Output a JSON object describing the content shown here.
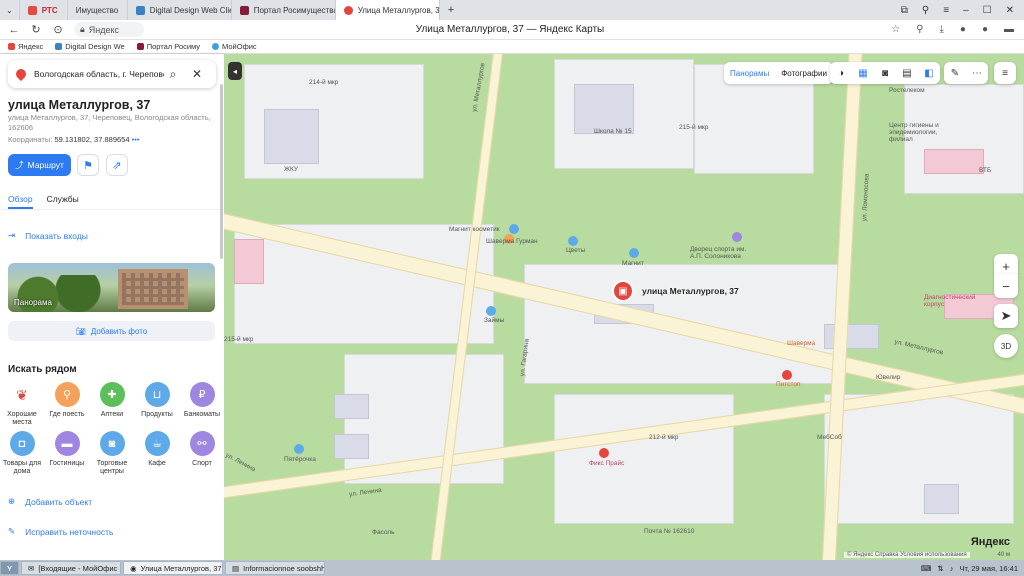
{
  "browser": {
    "tabs": [
      {
        "label": "Имущество",
        "color": "#e34b3f"
      },
      {
        "label": "Digital Design Web Client",
        "color": "#3b82c4"
      },
      {
        "label": "Портал Росимущества",
        "color": "#8a1a3a"
      },
      {
        "label": "Улица Металлургов, 37",
        "color": "#e4463b"
      }
    ],
    "rts_label": "РТС",
    "new_tab": "+",
    "page_title": "Улица Металлургов, 37 — Яндекс Карты",
    "url_text": "Яндекс",
    "bookmarks": [
      "Яндекс",
      "Digital Design We",
      "Портал Росиму",
      "МойОфис"
    ]
  },
  "sidebar": {
    "search_value": "Вологодская область, г. Череповец,",
    "title": "улица Металлургов, 37",
    "address": "улица Металлургов, 37, Череповец, Вологодская область, 162606",
    "coords_label": "Координаты:",
    "coords_value": "59.131802, 37.889654",
    "route_label": "Маршрут",
    "tabs": [
      "Обзор",
      "Службы"
    ],
    "show_entrances": "Показать входы",
    "panorama_label": "Панорама",
    "add_photo": "Добавить фото",
    "nearby_title": "Искать рядом",
    "categories": [
      {
        "label": "Хорошие места",
        "color": "#ffffff"
      },
      {
        "label": "Где поесть",
        "color": "#f4a259"
      },
      {
        "label": "Аптеки",
        "color": "#5bbf5a"
      },
      {
        "label": "Продукты",
        "color": "#5ea9e8"
      },
      {
        "label": "Банкоматы",
        "color": "#9f86e0"
      },
      {
        "label": "Товары для дома",
        "color": "#5ea9e8"
      },
      {
        "label": "Гостиницы",
        "color": "#9f86e0"
      },
      {
        "label": "Торговые центры",
        "color": "#5ea9e8"
      },
      {
        "label": "Кафе",
        "color": "#5ea9e8"
      },
      {
        "label": "Спорт",
        "color": "#9f86e0"
      }
    ],
    "add_object": "Добавить объект",
    "fix_error": "Исправить неточность"
  },
  "map": {
    "panoramas": "Панорамы",
    "photos": "Фотографии",
    "marker_label": "улица Металлургов, 37",
    "zoom_in": "+",
    "zoom_out": "−",
    "btn_3d": "3D",
    "brand": "Яндекс",
    "copyright": "© Яндекс  Справка  Условия использования",
    "scale": "40 м",
    "labels": {
      "street_metallurgov_w": "ул. Металлургов",
      "street_metallurgov_e": "ул. Металлургов",
      "street_lenina_w": "ул. Ленина",
      "street_lenina_e": "ул. Ленина",
      "street_gagarina": "ул. Гагарина",
      "street_lomonosova": "ул. Ломоносова",
      "school": "Школа № 15",
      "magnit_kosm": "Магнит косметик",
      "shaverma": "Шаверма Гурман",
      "tsvety": "Цветы",
      "magnit": "Магнит",
      "dvorets": "Дворец спорта им. А.П. Солоникова",
      "zaymi": "Займы",
      "shaverma2": "Шаверма",
      "pitstop": "Питстоп",
      "yuvelir": "Ювелир",
      "mebsob": "МебСоб",
      "pyaterochka": "Пятёрочка",
      "fikspraice": "Фикс Прайс",
      "fasol": "Фасоль",
      "pochta": "Почта № 162610",
      "rostelecom": "Ростелеком",
      "diag": "Диагностический корпус",
      "vtb": "ВТБ",
      "centr": "Центр гигиены и эпидемиологии, филиал",
      "mkr214": "214-й мкр",
      "mkr215e": "215-й мкр",
      "mkr215w": "215-й мкр",
      "mkr212": "212-й мкр",
      "zhkh": "ЖКУ"
    }
  },
  "taskbar": {
    "items": [
      "[Входящие - МойОфис П...",
      "Улица Металлургов, 37 ...",
      "Informacionnoe soobshhe..."
    ],
    "clock": "Чт, 29 мая, 16:41"
  }
}
